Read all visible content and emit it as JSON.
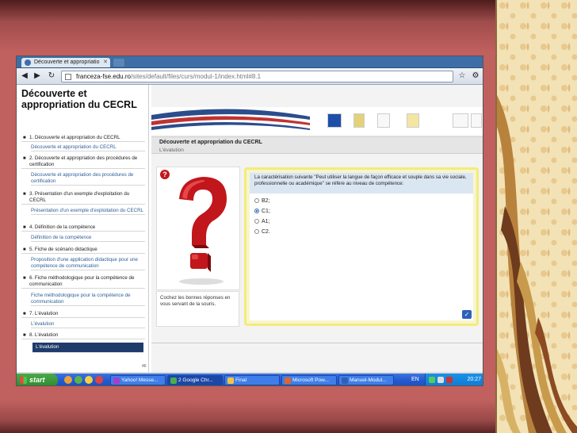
{
  "browser": {
    "tab_title": "Découverte et appropriatio",
    "url_host": "franceza-fse.edu.ro",
    "url_path": "/sites/default/files/curs/modul-1/index.html#8.1"
  },
  "sidebar": {
    "title": "Découverte et appropriation du CECRL",
    "items": [
      {
        "label": "1. Découverte et appropriation du CECRL",
        "sub": "Découverte et appropriation du CECRL"
      },
      {
        "label": "2. Découverte et appropriation des procédures de certification",
        "sub": "Découverte et appropriation des procédures de certification"
      },
      {
        "label": "3. Présentation d'un exemple d'exploitation du CECRL",
        "sub": "Présentation d'un exemple d'exploitation du CECRL"
      },
      {
        "label": "4. Définition de la compétence",
        "sub": "Définition de la compétence"
      },
      {
        "label": "5. Fiche de scénario didactique",
        "sub": "Proposition d'une application didactique pour une compétence de communication"
      },
      {
        "label": "6. Fiche méthodologique pour la compétence de communication",
        "sub": "Fiche méthodologique pour la compétence de communication"
      },
      {
        "label": "7. L'évalution",
        "sub": "L'évalution"
      },
      {
        "label": "8. L'évalution",
        "sub": "L'évalution"
      }
    ],
    "counter": "46"
  },
  "main": {
    "module_title": "Découverte et appropriation du CECRL",
    "section_title": "L'évalution",
    "help_label": "?",
    "instruction": "Cochez les bonnes réponses en vous servant de la souris.",
    "question": "La caractérisation suivante \"Peut utiliser la langue de façon efficace et souple dans sa vie sociale, professionnelle ou académique\" se réfère au niveau de compétence:",
    "options": [
      "B2;",
      "C1;",
      "A1;",
      "C2."
    ],
    "selected": "C1;"
  },
  "taskbar": {
    "start": "start",
    "buttons": [
      "Yahoo! Messe...",
      "2 Google Chr...",
      "Final",
      "Microsoft Pow...",
      "Manuel-Modul..."
    ],
    "lang": "EN",
    "clock": "20:27"
  }
}
